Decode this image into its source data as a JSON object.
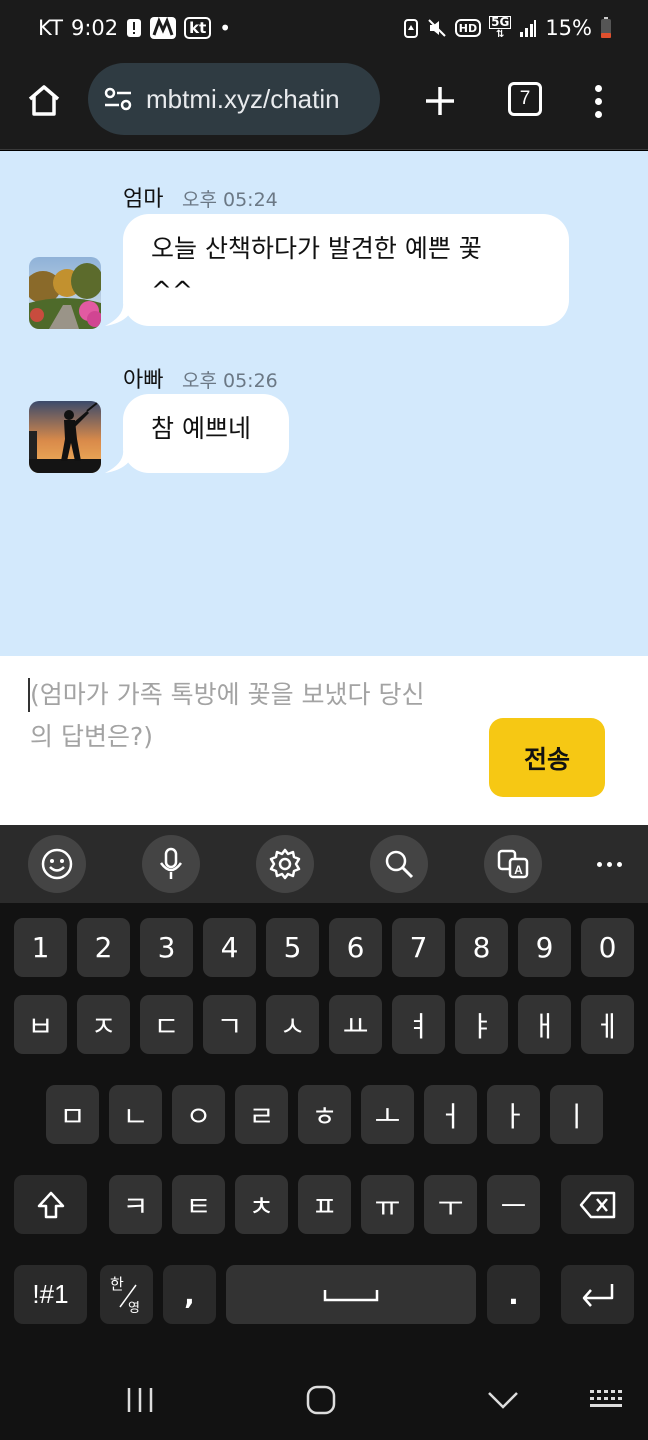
{
  "status_bar": {
    "carrier": "KT",
    "time": "9:02",
    "kt_badge": "kt",
    "battery": "15%",
    "network": "5G",
    "hd": "HD",
    "icons": [
      "alert-icon",
      "app-icon",
      "kt-icon",
      "dot-icon",
      "recycle-icon",
      "mute-icon",
      "hd-icon",
      "5g-icon",
      "signal-icon",
      "battery-icon"
    ]
  },
  "browser": {
    "url": "mbtmi.xyz/chatin",
    "tab_count": "7",
    "icons": [
      "home-icon",
      "site-settings-icon",
      "plus-icon",
      "tabs-icon",
      "more-vert-icon"
    ]
  },
  "chat": {
    "background": "#d3e9fc",
    "messages": [
      {
        "sender": "엄마",
        "time": "오후 05:24",
        "lines": [
          "오늘 산책하다가 발견한 예쁜 꽃",
          "^^"
        ],
        "avatar": "flower-garden-avatar"
      },
      {
        "sender": "아빠",
        "time": "오후 05:26",
        "lines": [
          "참 예쁘네"
        ],
        "avatar": "golfer-sunset-avatar"
      }
    ]
  },
  "composer": {
    "placeholder_lines": [
      "(엄마가 가족 톡방에 꽃을 보냈다 당신",
      "의 답변은?)"
    ],
    "send_label": "전송",
    "send_color": "#f6c814"
  },
  "keyboard": {
    "toolbar_icons": [
      "emoji-icon",
      "mic-icon",
      "settings-icon",
      "search-icon",
      "translate-icon",
      "more-horiz-icon"
    ],
    "number_row": [
      "1",
      "2",
      "3",
      "4",
      "5",
      "6",
      "7",
      "8",
      "9",
      "0"
    ],
    "row1": [
      "ㅂ",
      "ㅈ",
      "ㄷ",
      "ㄱ",
      "ㅅ",
      "ㅛ",
      "ㅕ",
      "ㅑ",
      "ㅐ",
      "ㅔ"
    ],
    "row2": [
      "ㅁ",
      "ㄴ",
      "ㅇ",
      "ㄹ",
      "ㅎ",
      "ㅗ",
      "ㅓ",
      "ㅏ",
      "ㅣ"
    ],
    "row3": [
      "ㅋ",
      "ㅌ",
      "ㅊ",
      "ㅍ",
      "ㅠ",
      "ㅜ",
      "ㅡ"
    ],
    "symbols_label": "!#1",
    "lang_top": "한",
    "lang_bottom": "영",
    "comma": ",",
    "period": ".",
    "icons": [
      "shift-icon",
      "backspace-icon",
      "space-icon",
      "enter-icon"
    ]
  },
  "nav_bar": {
    "icons": [
      "recents-icon",
      "home-circle-icon",
      "back-chevron-icon",
      "keyboard-hide-icon"
    ]
  }
}
